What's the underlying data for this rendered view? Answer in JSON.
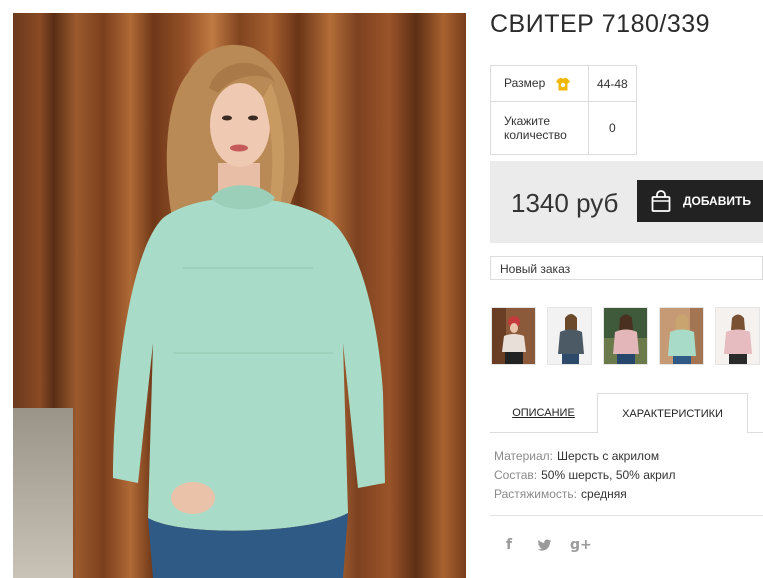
{
  "product": {
    "title": "СВИТЕР 7180/339",
    "size_label": "Размер",
    "size_value": "44-48",
    "qty_label_line1": "Укажите",
    "qty_label_line2": "количество",
    "qty_value": "0",
    "price": "1340 руб",
    "add_button_label": "ДОБАВИТЬ",
    "order_select": "Новый заказ"
  },
  "tabs": [
    {
      "label": "ОПИСАНИЕ"
    },
    {
      "label": "ХАРАКТЕРИСТИКИ"
    }
  ],
  "specs": [
    {
      "key": "Материал:",
      "value": "Шерсть с акрилом"
    },
    {
      "key": "Состав:",
      "value": "50% шерсть, 50% акрил"
    },
    {
      "key": "Растяжимость:",
      "value": "средняя"
    }
  ],
  "social": {
    "facebook": "f",
    "googleplus": "g+"
  },
  "colors": {
    "sweater": "#a9dcc8",
    "button_bg": "#222222",
    "pricebox_bg": "#ebebeb",
    "size_icon": "#f2b705"
  },
  "icons": [
    "size-chart-icon",
    "shopping-bag-icon",
    "facebook-icon",
    "twitter-icon",
    "google-plus-icon"
  ]
}
